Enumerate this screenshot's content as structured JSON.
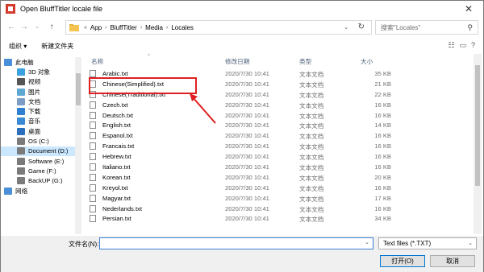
{
  "window": {
    "title": "Open BluffTitler locale file"
  },
  "address": {
    "crumbs": [
      "App",
      "BluffTitler",
      "Media",
      "Locales"
    ],
    "lead_chevron": "«"
  },
  "search": {
    "placeholder": "搜索\"Locales\""
  },
  "commands": {
    "organize": "组织 ▾",
    "new_folder": "新建文件夹"
  },
  "sidebar": {
    "items": [
      {
        "label": "此电脑",
        "icon": "computer-icon",
        "color": "#4a90d9"
      },
      {
        "label": "3D 对象",
        "icon": "cube-icon",
        "color": "#3aa0e0"
      },
      {
        "label": "视频",
        "icon": "video-icon",
        "color": "#555555"
      },
      {
        "label": "图片",
        "icon": "picture-icon",
        "color": "#5fa8d3"
      },
      {
        "label": "文档",
        "icon": "document-icon",
        "color": "#7a9cc6"
      },
      {
        "label": "下载",
        "icon": "download-icon",
        "color": "#2f80d0"
      },
      {
        "label": "音乐",
        "icon": "music-icon",
        "color": "#3a8ad6"
      },
      {
        "label": "桌面",
        "icon": "desktop-icon",
        "color": "#2d6fbf"
      },
      {
        "label": "OS (C:)",
        "icon": "drive-icon",
        "color": "#7a7a7a"
      },
      {
        "label": "Document (D:)",
        "icon": "drive-icon",
        "color": "#7a7a7a",
        "selected": true
      },
      {
        "label": "Software (E:)",
        "icon": "drive-icon",
        "color": "#7a7a7a"
      },
      {
        "label": "Game (F:)",
        "icon": "drive-icon",
        "color": "#7a7a7a"
      },
      {
        "label": "BackUP (G:)",
        "icon": "drive-icon",
        "color": "#7a7a7a"
      },
      {
        "label": "网络",
        "icon": "network-icon",
        "color": "#4a90d9"
      }
    ]
  },
  "columns": {
    "name": "名称",
    "date": "修改日期",
    "type": "类型",
    "size": "大小"
  },
  "files": [
    {
      "name": "Arabic.txt",
      "date": "2020/7/30 10:41",
      "type": "文本文档",
      "size": "35 KB"
    },
    {
      "name": "Chinese(Simplified).txt",
      "date": "2020/7/30 10:41",
      "type": "文本文档",
      "size": "21 KB"
    },
    {
      "name": "Chinese(Traditional).txt",
      "date": "2020/7/30 10:41",
      "type": "文本文档",
      "size": "22 KB"
    },
    {
      "name": "Czech.txt",
      "date": "2020/7/30 10:41",
      "type": "文本文档",
      "size": "16 KB"
    },
    {
      "name": "Deutsch.txt",
      "date": "2020/7/30 10:41",
      "type": "文本文档",
      "size": "16 KB"
    },
    {
      "name": "English.txt",
      "date": "2020/7/30 10:41",
      "type": "文本文档",
      "size": "14 KB"
    },
    {
      "name": "Espanol.txt",
      "date": "2020/7/30 10:41",
      "type": "文本文档",
      "size": "16 KB"
    },
    {
      "name": "Francais.txt",
      "date": "2020/7/30 10:41",
      "type": "文本文档",
      "size": "16 KB"
    },
    {
      "name": "Hebrew.txt",
      "date": "2020/7/30 10:41",
      "type": "文本文档",
      "size": "16 KB"
    },
    {
      "name": "Italiano.txt",
      "date": "2020/7/30 10:41",
      "type": "文本文档",
      "size": "16 KB"
    },
    {
      "name": "Korean.txt",
      "date": "2020/7/30 10:41",
      "type": "文本文档",
      "size": "20 KB"
    },
    {
      "name": "Kreyol.txt",
      "date": "2020/7/30 10:41",
      "type": "文本文档",
      "size": "16 KB"
    },
    {
      "name": "Magyar.txt",
      "date": "2020/7/30 10:41",
      "type": "文本文档",
      "size": "17 KB"
    },
    {
      "name": "Nederlands.txt",
      "date": "2020/7/30 10:41",
      "type": "文本文档",
      "size": "16 KB"
    },
    {
      "name": "Persian.txt",
      "date": "2020/7/30 10:41",
      "type": "文本文档",
      "size": "34 KB"
    }
  ],
  "footer": {
    "filename_label": "文件名(N):",
    "filename_value": "",
    "filetype": "Text files (*.TXT)",
    "open_label": "打开(O)",
    "cancel_label": "取消"
  },
  "colors": {
    "highlight": "#e02020",
    "selection": "#cce8ff",
    "accent": "#0078d7"
  }
}
